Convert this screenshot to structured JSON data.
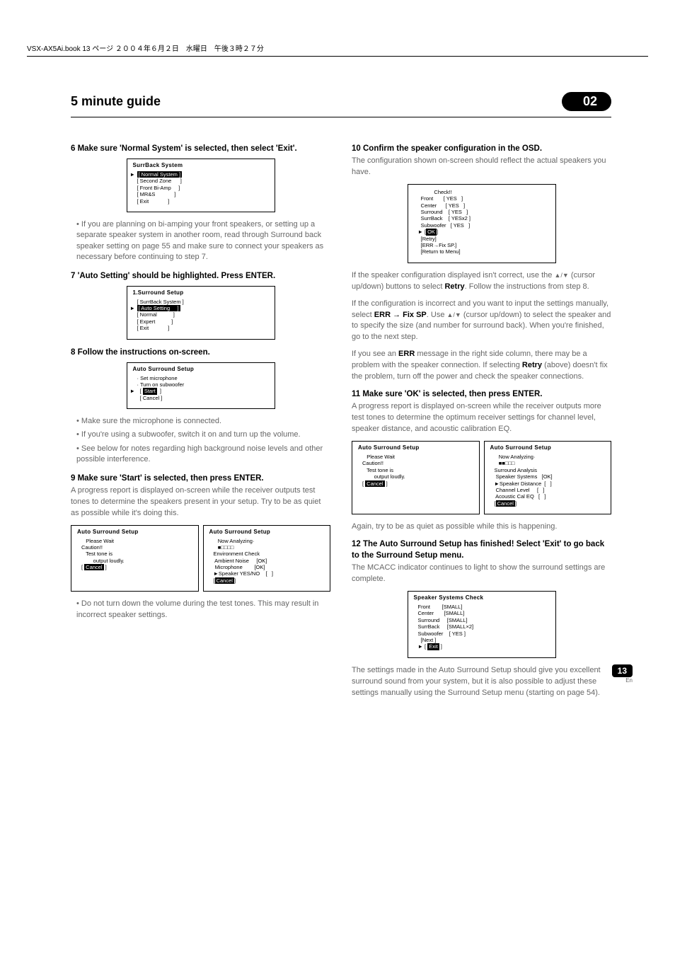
{
  "header_text": "VSX-AX5Ai.book  13 ページ  ２００４年６月２日　水曜日　午後３時２７分",
  "guide_title": "5 minute guide",
  "chapter_badge": "02",
  "left": {
    "s6_head": "6   Make sure 'Normal System' is selected, then select 'Exit'.",
    "osd1_title": "SurrBack System",
    "osd1_lines": [
      "[ Normal System ]",
      "[ Second Zone      ]",
      "[ Front Bi-Amp     ]",
      "[ MR&S             ]",
      "[ Exit             ]"
    ],
    "s6_b1": "If you are planning on bi-amping your front speakers, or setting up a separate speaker system in another room, read through Surround back speaker setting on page 55 and make sure to connect your speakers as necessary before continuing to step 7.",
    "s7_head": "7   'Auto Setting' should be highlighted. Press ENTER.",
    "osd2_title": "1.Surround Setup",
    "osd2_lines": [
      "[ SurrBack System ]",
      "[ Auto Setting     ]",
      "[ Normal           ]",
      "[ Expert           ]",
      "[ Exit             ]"
    ],
    "s8_head": "8   Follow the instructions on-screen.",
    "osd3_title": "Auto Surround Setup",
    "osd3_lines": [
      "· Set microphone",
      "· Turn on subwoofer",
      "",
      "",
      "  [ Start  ]",
      "  [ Cancel ]"
    ],
    "s8_b1": "Make sure the microphone is connected.",
    "s8_b2": "If you're using a subwoofer, switch it on and turn up the volume.",
    "s8_b3": "See below for notes regarding high background noise levels and other possible interference.",
    "s9_head": "9   Make sure 'Start' is selected, then press ENTER.",
    "s9_body": "A progress report is displayed on-screen while the receiver outputs test tones to determine the speakers present in your setup. Try to be as quiet as possible while it's doing this.",
    "osd4a_title": "Auto Surround Setup",
    "osd4a_lines": [
      "",
      "   Please Wait",
      "",
      "Caution!!",
      "   Test tone is",
      "        output loudly.",
      "",
      "[ Cancel ]"
    ],
    "osd4b_title": "Auto Surround Setup",
    "osd4b_lines": [
      "   Now Analyzing·",
      "   ■□□□□",
      "Environment Check",
      " Ambient Noise     [OK]",
      " Microphone        [OK]",
      "►Speaker YES/NO    [   ]",
      "",
      "[Cancel]"
    ],
    "s9_b1": "Do not turn down the volume during the test tones. This may result in incorrect speaker settings."
  },
  "right": {
    "s10_head": "10  Confirm the speaker configuration in the OSD.",
    "s10_body": "The configuration shown on-screen should reflect the actual speakers you have.",
    "osd5_lines": [
      "           Check!!",
      "  Front       [ YES   ]",
      "  Center      [ YES   ]",
      "  Surround    [ YES   ]",
      "  SurrBack    [ YESx2 ]",
      "  Subwoofer   [ YES   ]",
      "",
      "► [OK]",
      "  [Retry]",
      "  [ERR→Fix SP.]",
      "  [Return to Menu]"
    ],
    "s10_p2a": "If the speaker configuration displayed isn't correct, use the ",
    "s10_p2b": " (cursor up/down) buttons to select ",
    "s10_p2c": ". Follow the instructions from step 8.",
    "s10_p3a": "If the configuration is incorrect and you want to input the settings manually, select ",
    "s10_p3b": ". Use ",
    "s10_p3c": " (cursor up/down) to select the speaker and to specify the size (and number for surround back). When you're finished, go to the next step.",
    "s10_p4a": "If you see an ",
    "s10_p4b": " message in the right side column, there may be a problem with the speaker connection. If selecting ",
    "s10_p4c": " (above) doesn't fix the problem, turn off the power and check the speaker connections.",
    "retry_word": "Retry",
    "err_word": "ERR",
    "errfix_word": "ERR → Fix SP",
    "s11_head": "11  Make sure 'OK' is selected, then press ENTER.",
    "s11_body": "A progress report is displayed on-screen while the receiver outputs more test tones to determine the optimum receiver settings for channel level, speaker distance, and acoustic calibration EQ.",
    "osd6a_title": "Auto Surround Setup",
    "osd6a_lines": [
      "",
      "   Please Wait",
      "",
      "Caution!!",
      "   Test tone is",
      "        output loudly.",
      "",
      "[ Cancel ]"
    ],
    "osd6b_title": "Auto Surround Setup",
    "osd6b_lines": [
      "   Now Analyzing·",
      "   ■■□□□",
      "Surround Analysis",
      " Speaker Systems   [OK]",
      "►Speaker Distance  [   ]",
      " Channel Level     [   ]",
      " Acoustic Cal EQ   [   ]",
      "",
      "[Cancel]"
    ],
    "s11_p2": "Again, try to be as quiet as possible while this is happening.",
    "s12_head": "12  The Auto Surround Setup has finished! Select 'Exit' to go back to the Surround Setup menu.",
    "s12_body": "The MCACC indicator continues to light to show the surround settings are complete.",
    "osd7_title": "Speaker Systems Check",
    "osd7_lines": [
      "Front        [SMALL]",
      "Center       [SMALL]",
      "Surround     [SMALL]",
      "SurrBack     [SMALL×2]",
      "Subwoofer    [ YES ]",
      "",
      "  [Next ]",
      "► [ Exit ]"
    ],
    "s12_p2": "The settings made in the Auto Surround Setup should give you excellent surround sound from your system, but it is also possible to adjust these settings manually using the Surround Setup menu (starting on page 54)."
  },
  "page_number": "13",
  "page_lang": "En",
  "updown_glyph": "▲/▼"
}
